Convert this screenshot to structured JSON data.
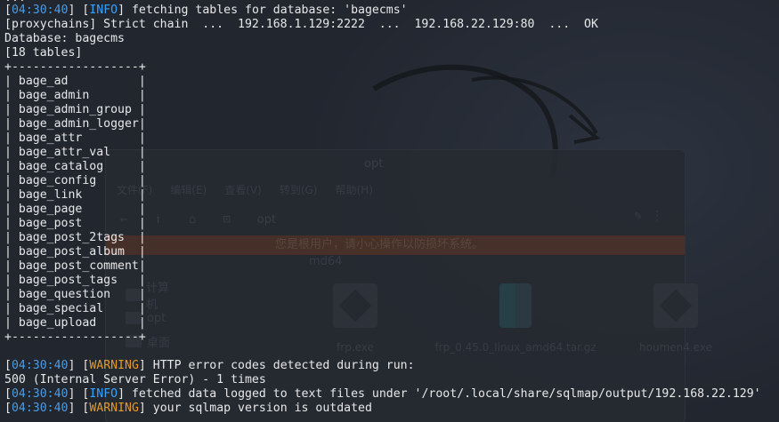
{
  "colors": {
    "background": "#22262f",
    "text": "#e8e8e8",
    "timestamp": "#4d9be0",
    "info": "#34a3ff",
    "warning": "#e09a2e"
  },
  "background_window": {
    "title": "opt",
    "menu": [
      "文件(F)",
      "编辑(E)",
      "查看(V)",
      "转到(G)",
      "帮助(H)"
    ],
    "path": "opt",
    "banner": "您是根用户，请小心操作以防损坏系统。",
    "crumb": "md64",
    "sidebar": [
      "计算机",
      "opt",
      "桌面"
    ],
    "files": [
      {
        "name": "frp.exe",
        "icon": "exe-icon"
      },
      {
        "name": "frp_0.45.0_linux_amd64.tar.gz",
        "icon": "archive-icon"
      },
      {
        "name": "houmen4.exe",
        "icon": "exe-icon"
      }
    ]
  },
  "terminal": {
    "top_partial": "...",
    "line1": {
      "ts": "04:30:40",
      "level": "INFO",
      "msg": " fetching tables for database: 'bagecms'"
    },
    "line2": "[proxychains] Strict chain  ...  192.168.1.129:2222  ...  192.168.22.129:80  ...  OK",
    "line3": "Database: bagecms",
    "line4": "[18 tables]",
    "table_border": "+------------------+",
    "tables": [
      "bage_ad",
      "bage_admin",
      "bage_admin_group",
      "bage_admin_logger",
      "bage_attr",
      "bage_attr_val",
      "bage_catalog",
      "bage_config",
      "bage_link",
      "bage_page",
      "bage_post",
      "bage_post_2tags",
      "bage_post_album",
      "bage_post_comment",
      "bage_post_tags",
      "bage_question",
      "bage_special",
      "bage_upload"
    ],
    "warn1": {
      "ts": "04:30:40",
      "level": "WARNING",
      "msg": " HTTP error codes detected during run:"
    },
    "line_500": "500 (Internal Server Error) - 1 times",
    "info2": {
      "ts": "04:30:40",
      "level": "INFO",
      "msg": " fetched data logged to text files under '/root/.local/share/sqlmap/output/192.168.22.129'"
    },
    "warn2": {
      "ts": "04:30:40",
      "level": "WARNING",
      "msg": " your sqlmap version is outdated"
    }
  }
}
